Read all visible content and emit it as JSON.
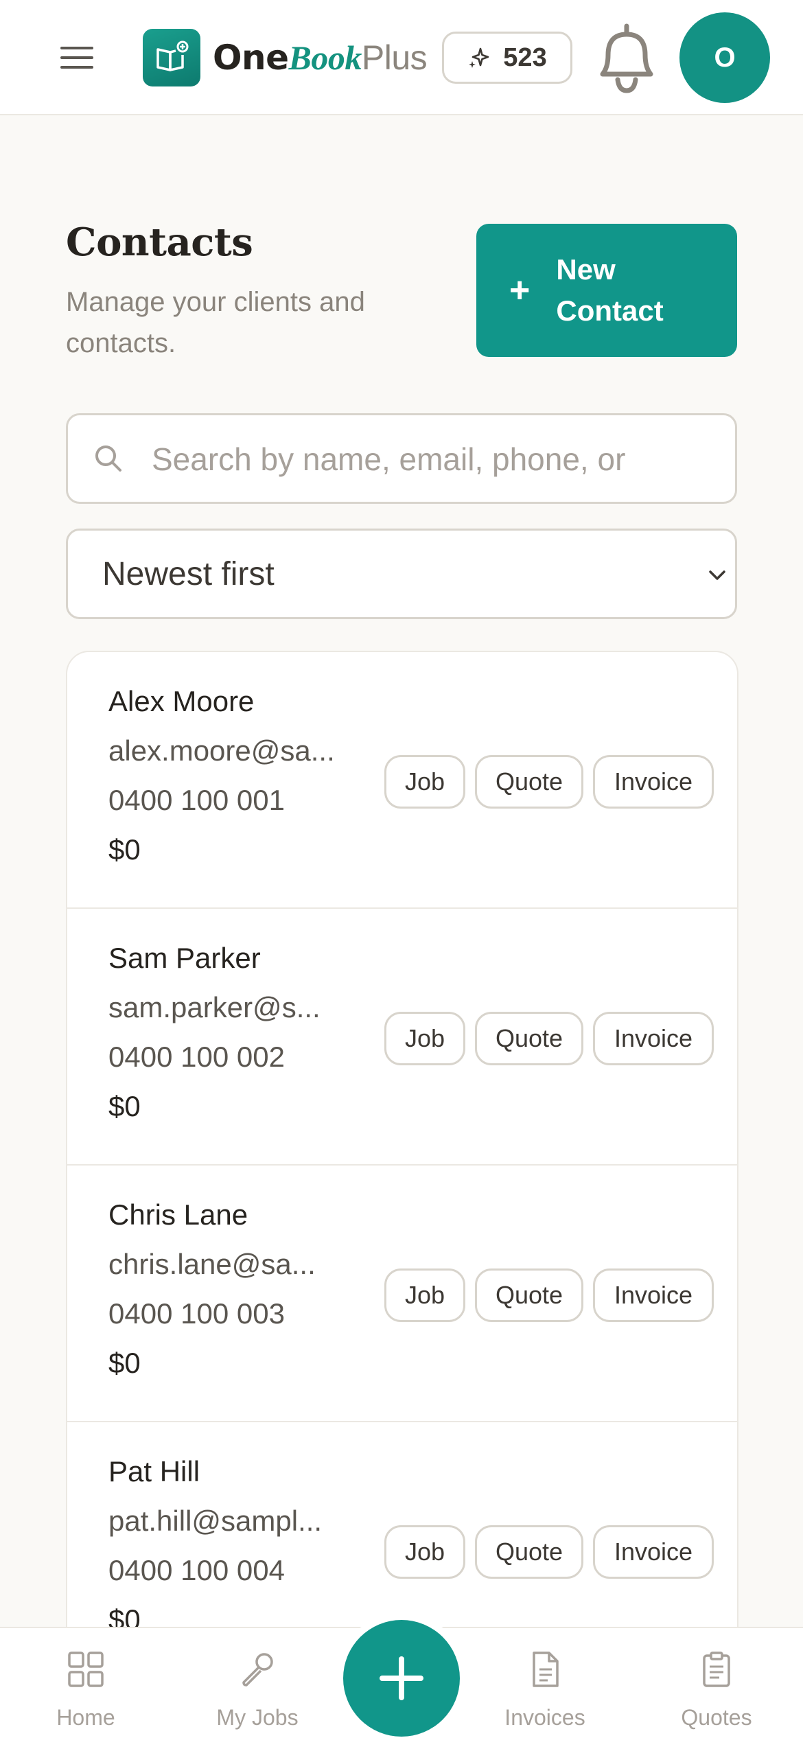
{
  "header": {
    "brand": {
      "one": "One",
      "book": "Book",
      "plus": "Plus"
    },
    "credits": "523",
    "avatar_initial": "O"
  },
  "page": {
    "title": "Contacts",
    "subtitle": "Manage your clients and contacts.",
    "new_contact_label": "New Contact"
  },
  "search": {
    "placeholder": "Search by name, email, phone, or"
  },
  "sort": {
    "selected": "Newest first"
  },
  "actions": {
    "job": "Job",
    "quote": "Quote",
    "invoice": "Invoice"
  },
  "contacts": [
    {
      "name": "Alex Moore",
      "email": "alex.moore@sa...",
      "phone": "0400 100 001",
      "amount": "$0"
    },
    {
      "name": "Sam Parker",
      "email": "sam.parker@s...",
      "phone": "0400 100 002",
      "amount": "$0"
    },
    {
      "name": "Chris Lane",
      "email": "chris.lane@sa...",
      "phone": "0400 100 003",
      "amount": "$0"
    },
    {
      "name": "Pat Hill",
      "email": "pat.hill@sampl...",
      "phone": "0400 100 004",
      "amount": "$0"
    }
  ],
  "nav": {
    "home": "Home",
    "jobs": "My Jobs",
    "invoices": "Invoices",
    "quotes": "Quotes"
  },
  "colors": {
    "accent": "#11968a",
    "background": "#faf9f6",
    "border": "#d8d4cc",
    "muted_text": "#8a847c"
  },
  "icons": {
    "menu": "hamburger-icon",
    "logo": "open-book-plus-icon",
    "credits": "sparkle-icon",
    "notifications": "bell-icon",
    "search": "search-icon",
    "sort": "chevron-down-icon",
    "home": "grid-icon",
    "jobs": "wrench-icon",
    "create": "plus-icon",
    "invoices": "document-icon",
    "quotes": "clipboard-icon"
  }
}
